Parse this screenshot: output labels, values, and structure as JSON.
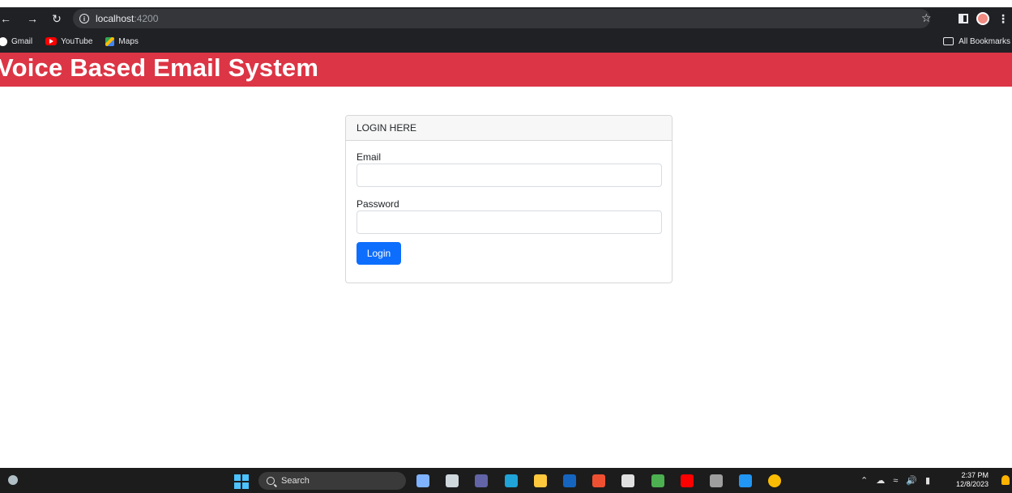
{
  "browser": {
    "url_host": "localhost",
    "url_port": ":4200",
    "bookmarks": [
      {
        "label": "Gmail",
        "icon": "gmail-icon"
      },
      {
        "label": "YouTube",
        "icon": "youtube-icon"
      },
      {
        "label": "Maps",
        "icon": "maps-icon"
      }
    ],
    "all_bookmarks_label": "All Bookmarks"
  },
  "app": {
    "title": "Voice Based Email System",
    "header_color": "#dc3545"
  },
  "login": {
    "header": "LOGIN HERE",
    "email_label": "Email",
    "email_value": "",
    "password_label": "Password",
    "password_value": "",
    "button_label": "Login",
    "button_color": "#0d6efd"
  },
  "taskbar": {
    "search_label": "Search",
    "apps": [
      {
        "name": "copilot-icon",
        "color": "#7fb3ff"
      },
      {
        "name": "task-view-icon",
        "color": "#cfd8dc"
      },
      {
        "name": "teams-icon",
        "color": "#6264a7"
      },
      {
        "name": "edge-icon",
        "color": "#1fa3d8"
      },
      {
        "name": "file-explorer-icon",
        "color": "#ffc83d"
      },
      {
        "name": "l-app-icon",
        "color": "#1565c0"
      },
      {
        "name": "git-icon",
        "color": "#f05032"
      },
      {
        "name": "calculator-icon",
        "color": "#e0e0e0"
      },
      {
        "name": "app-green-icon",
        "color": "#4caf50"
      },
      {
        "name": "youtube-app-icon",
        "color": "#ff0000"
      },
      {
        "name": "terminal-icon",
        "color": "#9e9e9e"
      },
      {
        "name": "vscode-icon",
        "color": "#2196f3"
      },
      {
        "name": "chrome-icon",
        "color": "#fbbc04"
      }
    ],
    "time": "2:37 PM",
    "date": "12/8/2023"
  }
}
